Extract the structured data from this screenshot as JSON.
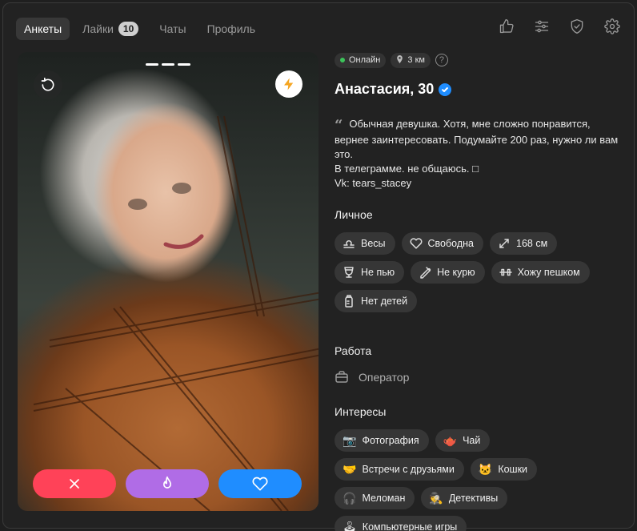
{
  "nav": {
    "tabs": [
      {
        "label": "Анкеты"
      },
      {
        "label": "Лайки",
        "badge": "10"
      },
      {
        "label": "Чаты"
      },
      {
        "label": "Профиль"
      }
    ],
    "icons": [
      "like-icon",
      "filters-icon",
      "shield-icon",
      "gear-icon"
    ]
  },
  "photo": {
    "pages": 3,
    "current_page": 1
  },
  "profile": {
    "status": "Онлайн",
    "distance": "3 км",
    "help": "?",
    "name": "Анастасия, 30",
    "verified": true,
    "bio_lines": [
      "Обычная девушка. Хотя, мне сложно понравится,",
      "вернее заинтересовать. Подумайте 200 раз, нужно ли вам",
      "это.",
      "В телеграмме. не общаюсь. □",
      "Vk: tears_stacey"
    ]
  },
  "personal": {
    "title": "Личное",
    "chips": [
      {
        "icon": "libra-icon",
        "label": "Весы"
      },
      {
        "icon": "heart-outline-icon",
        "label": "Свободна"
      },
      {
        "icon": "height-icon",
        "label": "168 см"
      },
      {
        "icon": "glass-icon",
        "label": "Не пью"
      },
      {
        "icon": "no-smoking-icon",
        "label": "Не курю"
      },
      {
        "icon": "dumbbell-icon",
        "label": "Хожу пешком"
      },
      {
        "icon": "baby-bottle-icon",
        "label": "Нет детей"
      }
    ]
  },
  "work": {
    "title": "Работа",
    "job": "Оператор",
    "icon": "briefcase-icon"
  },
  "interests": {
    "title": "Интересы",
    "chips": [
      {
        "emoji": "📷",
        "label": "Фотография"
      },
      {
        "emoji": "🫖",
        "label": "Чай"
      },
      {
        "emoji": "🤝",
        "label": "Встречи с друзьями"
      },
      {
        "emoji": "🐱",
        "label": "Кошки"
      },
      {
        "emoji": "🎧",
        "label": "Меломан"
      },
      {
        "emoji": "🕵",
        "label": "Детективы"
      },
      {
        "emoji": "🕹",
        "label": "Компьютерные игры"
      }
    ]
  },
  "colors": {
    "dislike": "#ff4258",
    "super": "#b06ce6",
    "like": "#1f8dff",
    "online": "#3cc35a",
    "boost": "#f5a623"
  }
}
